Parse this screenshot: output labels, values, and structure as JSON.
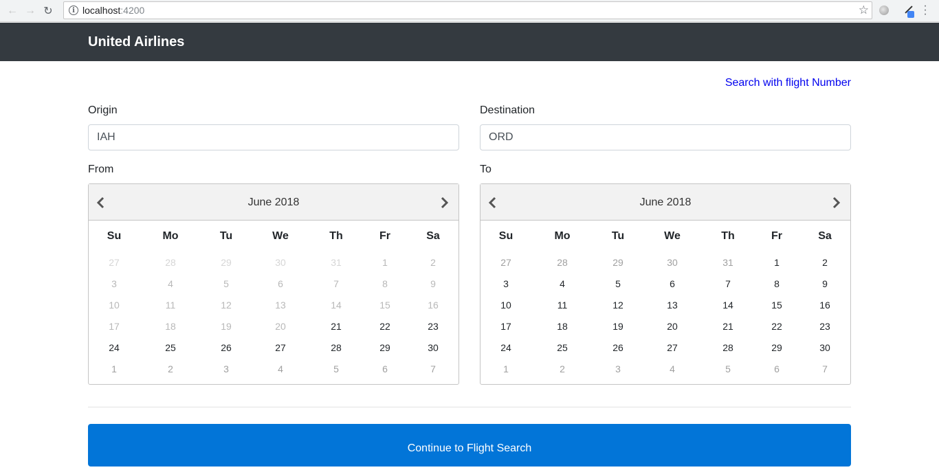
{
  "browser": {
    "url_host": "localhost",
    "url_port": ":4200"
  },
  "navbar": {
    "brand": "United Airlines"
  },
  "search_by_number_link": "Search with flight Number",
  "origin": {
    "label": "Origin",
    "value": "IAH"
  },
  "destination": {
    "label": "Destination",
    "value": "ORD"
  },
  "from": {
    "label": "From",
    "month": "June 2018",
    "weekdays": [
      "Su",
      "Mo",
      "Tu",
      "We",
      "Th",
      "Fr",
      "Sa"
    ],
    "weeks": [
      [
        {
          "d": "27",
          "s": "faint"
        },
        {
          "d": "28",
          "s": "faint"
        },
        {
          "d": "29",
          "s": "faint"
        },
        {
          "d": "30",
          "s": "faint"
        },
        {
          "d": "31",
          "s": "faint"
        },
        {
          "d": "1",
          "s": "muted"
        },
        {
          "d": "2",
          "s": "muted"
        }
      ],
      [
        {
          "d": "3",
          "s": "muted"
        },
        {
          "d": "4",
          "s": "muted"
        },
        {
          "d": "5",
          "s": "muted"
        },
        {
          "d": "6",
          "s": "muted"
        },
        {
          "d": "7",
          "s": "muted"
        },
        {
          "d": "8",
          "s": "muted"
        },
        {
          "d": "9",
          "s": "muted"
        }
      ],
      [
        {
          "d": "10",
          "s": "muted"
        },
        {
          "d": "11",
          "s": "muted"
        },
        {
          "d": "12",
          "s": "muted"
        },
        {
          "d": "13",
          "s": "muted"
        },
        {
          "d": "14",
          "s": "muted"
        },
        {
          "d": "15",
          "s": "muted"
        },
        {
          "d": "16",
          "s": "muted"
        }
      ],
      [
        {
          "d": "17",
          "s": "muted"
        },
        {
          "d": "18",
          "s": "muted"
        },
        {
          "d": "19",
          "s": "muted"
        },
        {
          "d": "20",
          "s": "muted"
        },
        {
          "d": "21",
          "s": "active"
        },
        {
          "d": "22",
          "s": "active"
        },
        {
          "d": "23",
          "s": "active"
        }
      ],
      [
        {
          "d": "24",
          "s": "active"
        },
        {
          "d": "25",
          "s": "active"
        },
        {
          "d": "26",
          "s": "active"
        },
        {
          "d": "27",
          "s": "active"
        },
        {
          "d": "28",
          "s": "active"
        },
        {
          "d": "29",
          "s": "active"
        },
        {
          "d": "30",
          "s": "active"
        }
      ],
      [
        {
          "d": "1",
          "s": "other"
        },
        {
          "d": "2",
          "s": "other"
        },
        {
          "d": "3",
          "s": "other"
        },
        {
          "d": "4",
          "s": "other"
        },
        {
          "d": "5",
          "s": "other"
        },
        {
          "d": "6",
          "s": "other"
        },
        {
          "d": "7",
          "s": "other"
        }
      ]
    ]
  },
  "to": {
    "label": "To",
    "month": "June 2018",
    "weekdays": [
      "Su",
      "Mo",
      "Tu",
      "We",
      "Th",
      "Fr",
      "Sa"
    ],
    "weeks": [
      [
        {
          "d": "27",
          "s": "other"
        },
        {
          "d": "28",
          "s": "other"
        },
        {
          "d": "29",
          "s": "other"
        },
        {
          "d": "30",
          "s": "other"
        },
        {
          "d": "31",
          "s": "other"
        },
        {
          "d": "1",
          "s": "active"
        },
        {
          "d": "2",
          "s": "active"
        }
      ],
      [
        {
          "d": "3",
          "s": "active"
        },
        {
          "d": "4",
          "s": "active"
        },
        {
          "d": "5",
          "s": "active"
        },
        {
          "d": "6",
          "s": "active"
        },
        {
          "d": "7",
          "s": "active"
        },
        {
          "d": "8",
          "s": "active"
        },
        {
          "d": "9",
          "s": "active"
        }
      ],
      [
        {
          "d": "10",
          "s": "active"
        },
        {
          "d": "11",
          "s": "active"
        },
        {
          "d": "12",
          "s": "active"
        },
        {
          "d": "13",
          "s": "active"
        },
        {
          "d": "14",
          "s": "active"
        },
        {
          "d": "15",
          "s": "active"
        },
        {
          "d": "16",
          "s": "active"
        }
      ],
      [
        {
          "d": "17",
          "s": "active"
        },
        {
          "d": "18",
          "s": "active"
        },
        {
          "d": "19",
          "s": "active"
        },
        {
          "d": "20",
          "s": "active"
        },
        {
          "d": "21",
          "s": "active"
        },
        {
          "d": "22",
          "s": "active"
        },
        {
          "d": "23",
          "s": "active"
        }
      ],
      [
        {
          "d": "24",
          "s": "active"
        },
        {
          "d": "25",
          "s": "active"
        },
        {
          "d": "26",
          "s": "active"
        },
        {
          "d": "27",
          "s": "active"
        },
        {
          "d": "28",
          "s": "active"
        },
        {
          "d": "29",
          "s": "active"
        },
        {
          "d": "30",
          "s": "active"
        }
      ],
      [
        {
          "d": "1",
          "s": "other"
        },
        {
          "d": "2",
          "s": "other"
        },
        {
          "d": "3",
          "s": "other"
        },
        {
          "d": "4",
          "s": "other"
        },
        {
          "d": "5",
          "s": "other"
        },
        {
          "d": "6",
          "s": "other"
        },
        {
          "d": "7",
          "s": "other"
        }
      ]
    ]
  },
  "continue_button": "Continue to Flight Search",
  "colors": {
    "navbar": "#343a40",
    "primary": "#0275d8",
    "link": "#0000ee"
  }
}
